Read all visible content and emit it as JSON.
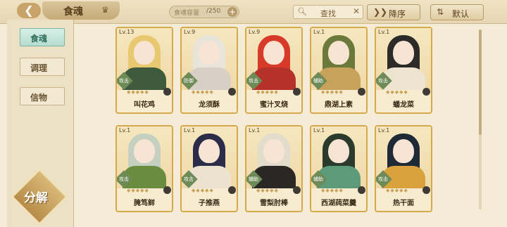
{
  "header": {
    "back_icon": "back-arrow-icon",
    "title": "食魂",
    "capacity_label": "食魂容量",
    "capacity_current": "",
    "capacity_sep": "/250",
    "search_placeholder": "查找",
    "sort_label": "降序",
    "filter_label": "默认"
  },
  "sidebar": {
    "tabs": [
      {
        "label": "食魂",
        "active": true
      },
      {
        "label": "调理",
        "active": false
      },
      {
        "label": "信物",
        "active": false
      }
    ],
    "decompose_label": "分解"
  },
  "cards": [
    {
      "level": "Lv.13",
      "name": "叫花鸡",
      "tag": "攻击",
      "stars": "◆◆◆◆◆",
      "hair": "#e8c870",
      "body": "#3e5a3c"
    },
    {
      "level": "Lv.9",
      "name": "龙须酥",
      "tag": "防御",
      "stars": "◆◆◆◆◆",
      "hair": "#e9e4da",
      "body": "#d8d0c4"
    },
    {
      "level": "Lv.9",
      "name": "蜜汁叉烧",
      "tag": "攻击",
      "stars": "◆◆◆◆◆",
      "hair": "#d83a2a",
      "body": "#b5322a"
    },
    {
      "level": "Lv.1",
      "name": "鼎湖上素",
      "tag": "辅助",
      "stars": "◆◆◆◆◆",
      "hair": "#6b7a3a",
      "body": "#c8a25a"
    },
    {
      "level": "Lv.1",
      "name": "蟠龙菜",
      "tag": "攻击",
      "stars": "◆◆◆◆◆",
      "hair": "#2d2a2a",
      "body": "#ece4cf"
    },
    {
      "level": "Lv.1",
      "name": "腌笃鲜",
      "tag": "攻击",
      "stars": "◆◆◆◆◆",
      "hair": "#c6d0c0",
      "body": "#6a8c3e"
    },
    {
      "level": "Lv.1",
      "name": "子推燕",
      "tag": "攻击",
      "stars": "◆◆◆◆◆",
      "hair": "#2b2b4a",
      "body": "#ede2d0"
    },
    {
      "level": "Lv.1",
      "name": "雪梨肘棒",
      "tag": "辅助",
      "stars": "◆◆◆◆◆",
      "hair": "#e2dccc",
      "body": "#2a2724"
    },
    {
      "level": "Lv.1",
      "name": "西湖莼菜羹",
      "tag": "辅助",
      "stars": "◆◆◆◆◆",
      "hair": "#2a3a2c",
      "body": "#5c9a7a"
    },
    {
      "level": "Lv.1",
      "name": "热干面",
      "tag": "攻击",
      "stars": "◆◆◆◆◆",
      "hair": "#1e2a36",
      "body": "#d9a23c"
    }
  ],
  "colors": {
    "accent_gold": "#d6a94a",
    "active_tab": "#7bb6a3",
    "background": "#f4ecd6"
  }
}
